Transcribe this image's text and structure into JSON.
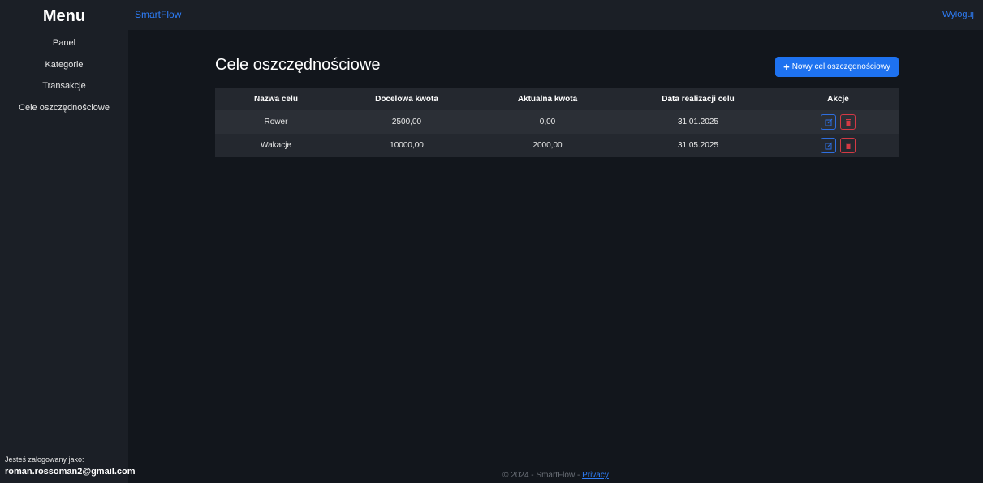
{
  "sidebar": {
    "title": "Menu",
    "items": [
      {
        "label": "Panel"
      },
      {
        "label": "Kategorie"
      },
      {
        "label": "Transakcje"
      },
      {
        "label": "Cele oszczędnościowe"
      }
    ],
    "user_label": "Jesteś zalogowany jako:",
    "user_email": "roman.rossoman2@gmail.com"
  },
  "topbar": {
    "brand": "SmartFlow",
    "logout": "Wyloguj"
  },
  "main": {
    "title": "Cele oszczędnościowe",
    "new_button": "Nowy cel oszczędnościowy",
    "table": {
      "headers": [
        "Nazwa celu",
        "Docelowa kwota",
        "Aktualna kwota",
        "Data realizacji celu",
        "Akcje"
      ],
      "rows": [
        {
          "name": "Rower",
          "target": "2500,00",
          "current": "0,00",
          "date": "31.01.2025"
        },
        {
          "name": "Wakacje",
          "target": "10000,00",
          "current": "2000,00",
          "date": "31.05.2025"
        }
      ]
    }
  },
  "footer": {
    "text": "© 2024 - SmartFlow - ",
    "link": "Privacy"
  },
  "colors": {
    "accent": "#1e72f0",
    "danger": "#d43a44",
    "background": "#12161c",
    "panel": "#1b1f26"
  },
  "icons": {
    "plus": "plus-icon",
    "edit": "edit-icon",
    "delete": "trash-icon"
  }
}
